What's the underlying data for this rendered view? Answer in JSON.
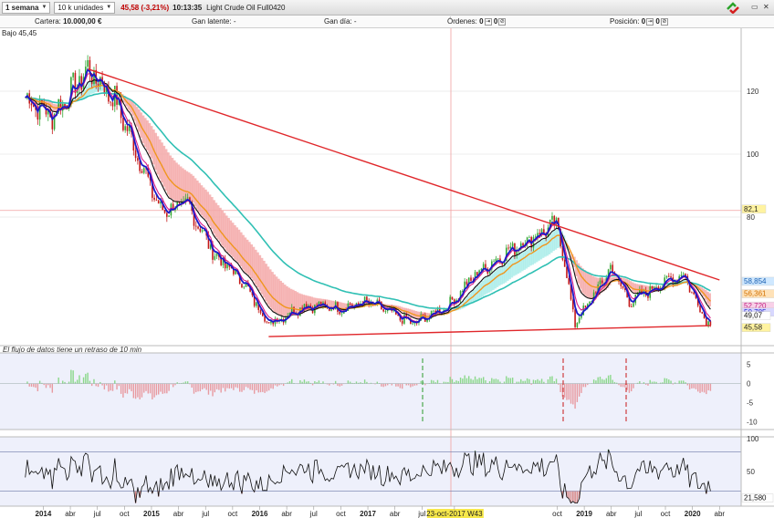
{
  "toolbar": {
    "timeframe": "1 semana",
    "units": "10 k unidades",
    "price_change": "45,58 (-3,21%)",
    "time": "10:13:35",
    "instrument": "Light Crude Oil Full0420"
  },
  "info_bar": {
    "cartera_label": "Cartera:",
    "cartera_value": "10.000,00 €",
    "gan_latente_label": "Gan latente:",
    "gan_latente_value": "-",
    "gan_dia_label": "Gan día:",
    "gan_dia_value": "-",
    "ordenes_label": "Órdenes:",
    "ordenes_value": "0",
    "ordenes_value2": "0",
    "posicion_label": "Posición:",
    "posicion_value": "0",
    "posicion_value2": "0"
  },
  "colors": {
    "trendline": "#e0262a",
    "ema_fast": "#1a1ac8",
    "ema_pink": "#d8208c",
    "ema_black": "#111111",
    "ema_orange": "#f0961e",
    "ema_teal": "#30c0b4",
    "cloud_bear": "#f4a8a8",
    "cloud_bull": "#a8ece8",
    "candle_up": "#36a836",
    "candle_down": "#c41818"
  },
  "chart_data": [
    {
      "type": "candlestick",
      "title": "Bajo 45,45",
      "notice": "El flujo de datos tiene un retraso de 10 min",
      "yticks": [
        "120",
        "100",
        "80"
      ],
      "xticks": [
        "2014",
        "abr",
        "jul",
        "oct",
        "2015",
        "abr",
        "jul",
        "oct",
        "2016",
        "abr",
        "jul",
        "oct",
        "2017",
        "abr",
        "jul",
        "23-oct-2017 W43",
        "oct",
        "2019",
        "abr",
        "jul",
        "oct",
        "2020",
        "abr"
      ],
      "ylim": [
        40,
        130
      ],
      "price_labels": [
        "82,1",
        "58,854",
        "56,361",
        "52,720",
        "50,785",
        "49,07",
        "45,58"
      ],
      "trend_points": [
        {
          "date": "2013-11",
          "value": 118
        },
        {
          "date": "2014-02",
          "value": 112
        },
        {
          "date": "2014-06",
          "value": 127
        },
        {
          "date": "2014-09",
          "value": 117
        },
        {
          "date": "2014-12",
          "value": 96
        },
        {
          "date": "2015-02",
          "value": 82
        },
        {
          "date": "2015-05",
          "value": 84
        },
        {
          "date": "2015-08",
          "value": 68
        },
        {
          "date": "2015-11",
          "value": 60
        },
        {
          "date": "2016-02",
          "value": 46
        },
        {
          "date": "2016-06",
          "value": 52
        },
        {
          "date": "2016-10",
          "value": 51
        },
        {
          "date": "2017-01",
          "value": 53
        },
        {
          "date": "2017-06",
          "value": 46
        },
        {
          "date": "2017-10",
          "value": 52
        },
        {
          "date": "2018-01",
          "value": 62
        },
        {
          "date": "2018-05",
          "value": 70
        },
        {
          "date": "2018-10",
          "value": 78
        },
        {
          "date": "2018-12",
          "value": 46
        },
        {
          "date": "2019-04",
          "value": 64
        },
        {
          "date": "2019-06",
          "value": 53
        },
        {
          "date": "2019-09",
          "value": 58
        },
        {
          "date": "2019-12",
          "value": 62
        },
        {
          "date": "2020-02",
          "value": 50
        },
        {
          "date": "2020-03",
          "value": 45.58
        }
      ],
      "resistance_line": [
        {
          "date": "2014-06",
          "value": 127
        },
        {
          "date": "2020-04",
          "value": 60
        }
      ],
      "support_line": [
        {
          "date": "2016-02",
          "value": 42
        },
        {
          "date": "2020-03",
          "value": 45.5
        }
      ]
    },
    {
      "type": "area",
      "name": "momentum",
      "yticks": [
        "5",
        "0",
        "-5",
        "-10"
      ],
      "ylim": [
        -12,
        8
      ]
    },
    {
      "type": "line",
      "name": "oscillator",
      "yticks": [
        "100",
        "50"
      ],
      "value_label": "21,580",
      "ylim": [
        0,
        100
      ]
    }
  ]
}
